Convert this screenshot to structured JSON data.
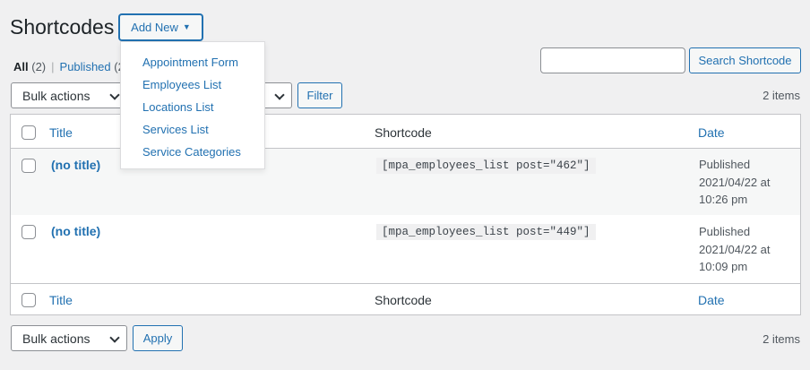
{
  "header": {
    "title": "Shortcodes",
    "add_new_label": "Add New",
    "caret": "▼"
  },
  "add_new_menu": [
    {
      "label": "Appointment Form"
    },
    {
      "label": "Employees List"
    },
    {
      "label": "Locations List"
    },
    {
      "label": "Services List"
    },
    {
      "label": "Service Categories"
    }
  ],
  "views": {
    "all_label": "All",
    "all_count": "(2)",
    "separator": "|",
    "published_label": "Published",
    "published_count": "(2"
  },
  "search": {
    "value": "",
    "button_label": "Search Shortcode"
  },
  "tablenav_top": {
    "bulk_actions": "Bulk actions",
    "filter_label": "Filter",
    "items_count": "2 items"
  },
  "table": {
    "columns": {
      "title": "Title",
      "shortcode": "Shortcode",
      "date": "Date"
    },
    "rows": [
      {
        "title": "(no title)",
        "shortcode": "[mpa_employees_list post=\"462\"]",
        "status": "Published",
        "date": "2021/04/22 at",
        "time": "10:26 pm"
      },
      {
        "title": "(no title)",
        "shortcode": "[mpa_employees_list post=\"449\"]",
        "status": "Published",
        "date": "2021/04/22 at",
        "time": "10:09 pm"
      }
    ]
  },
  "tablenav_bottom": {
    "bulk_actions": "Bulk actions",
    "apply_label": "Apply",
    "items_count": "2 items"
  },
  "colors": {
    "accent": "#2271b1",
    "background": "#f0f0f1",
    "text": "#1d2327"
  }
}
